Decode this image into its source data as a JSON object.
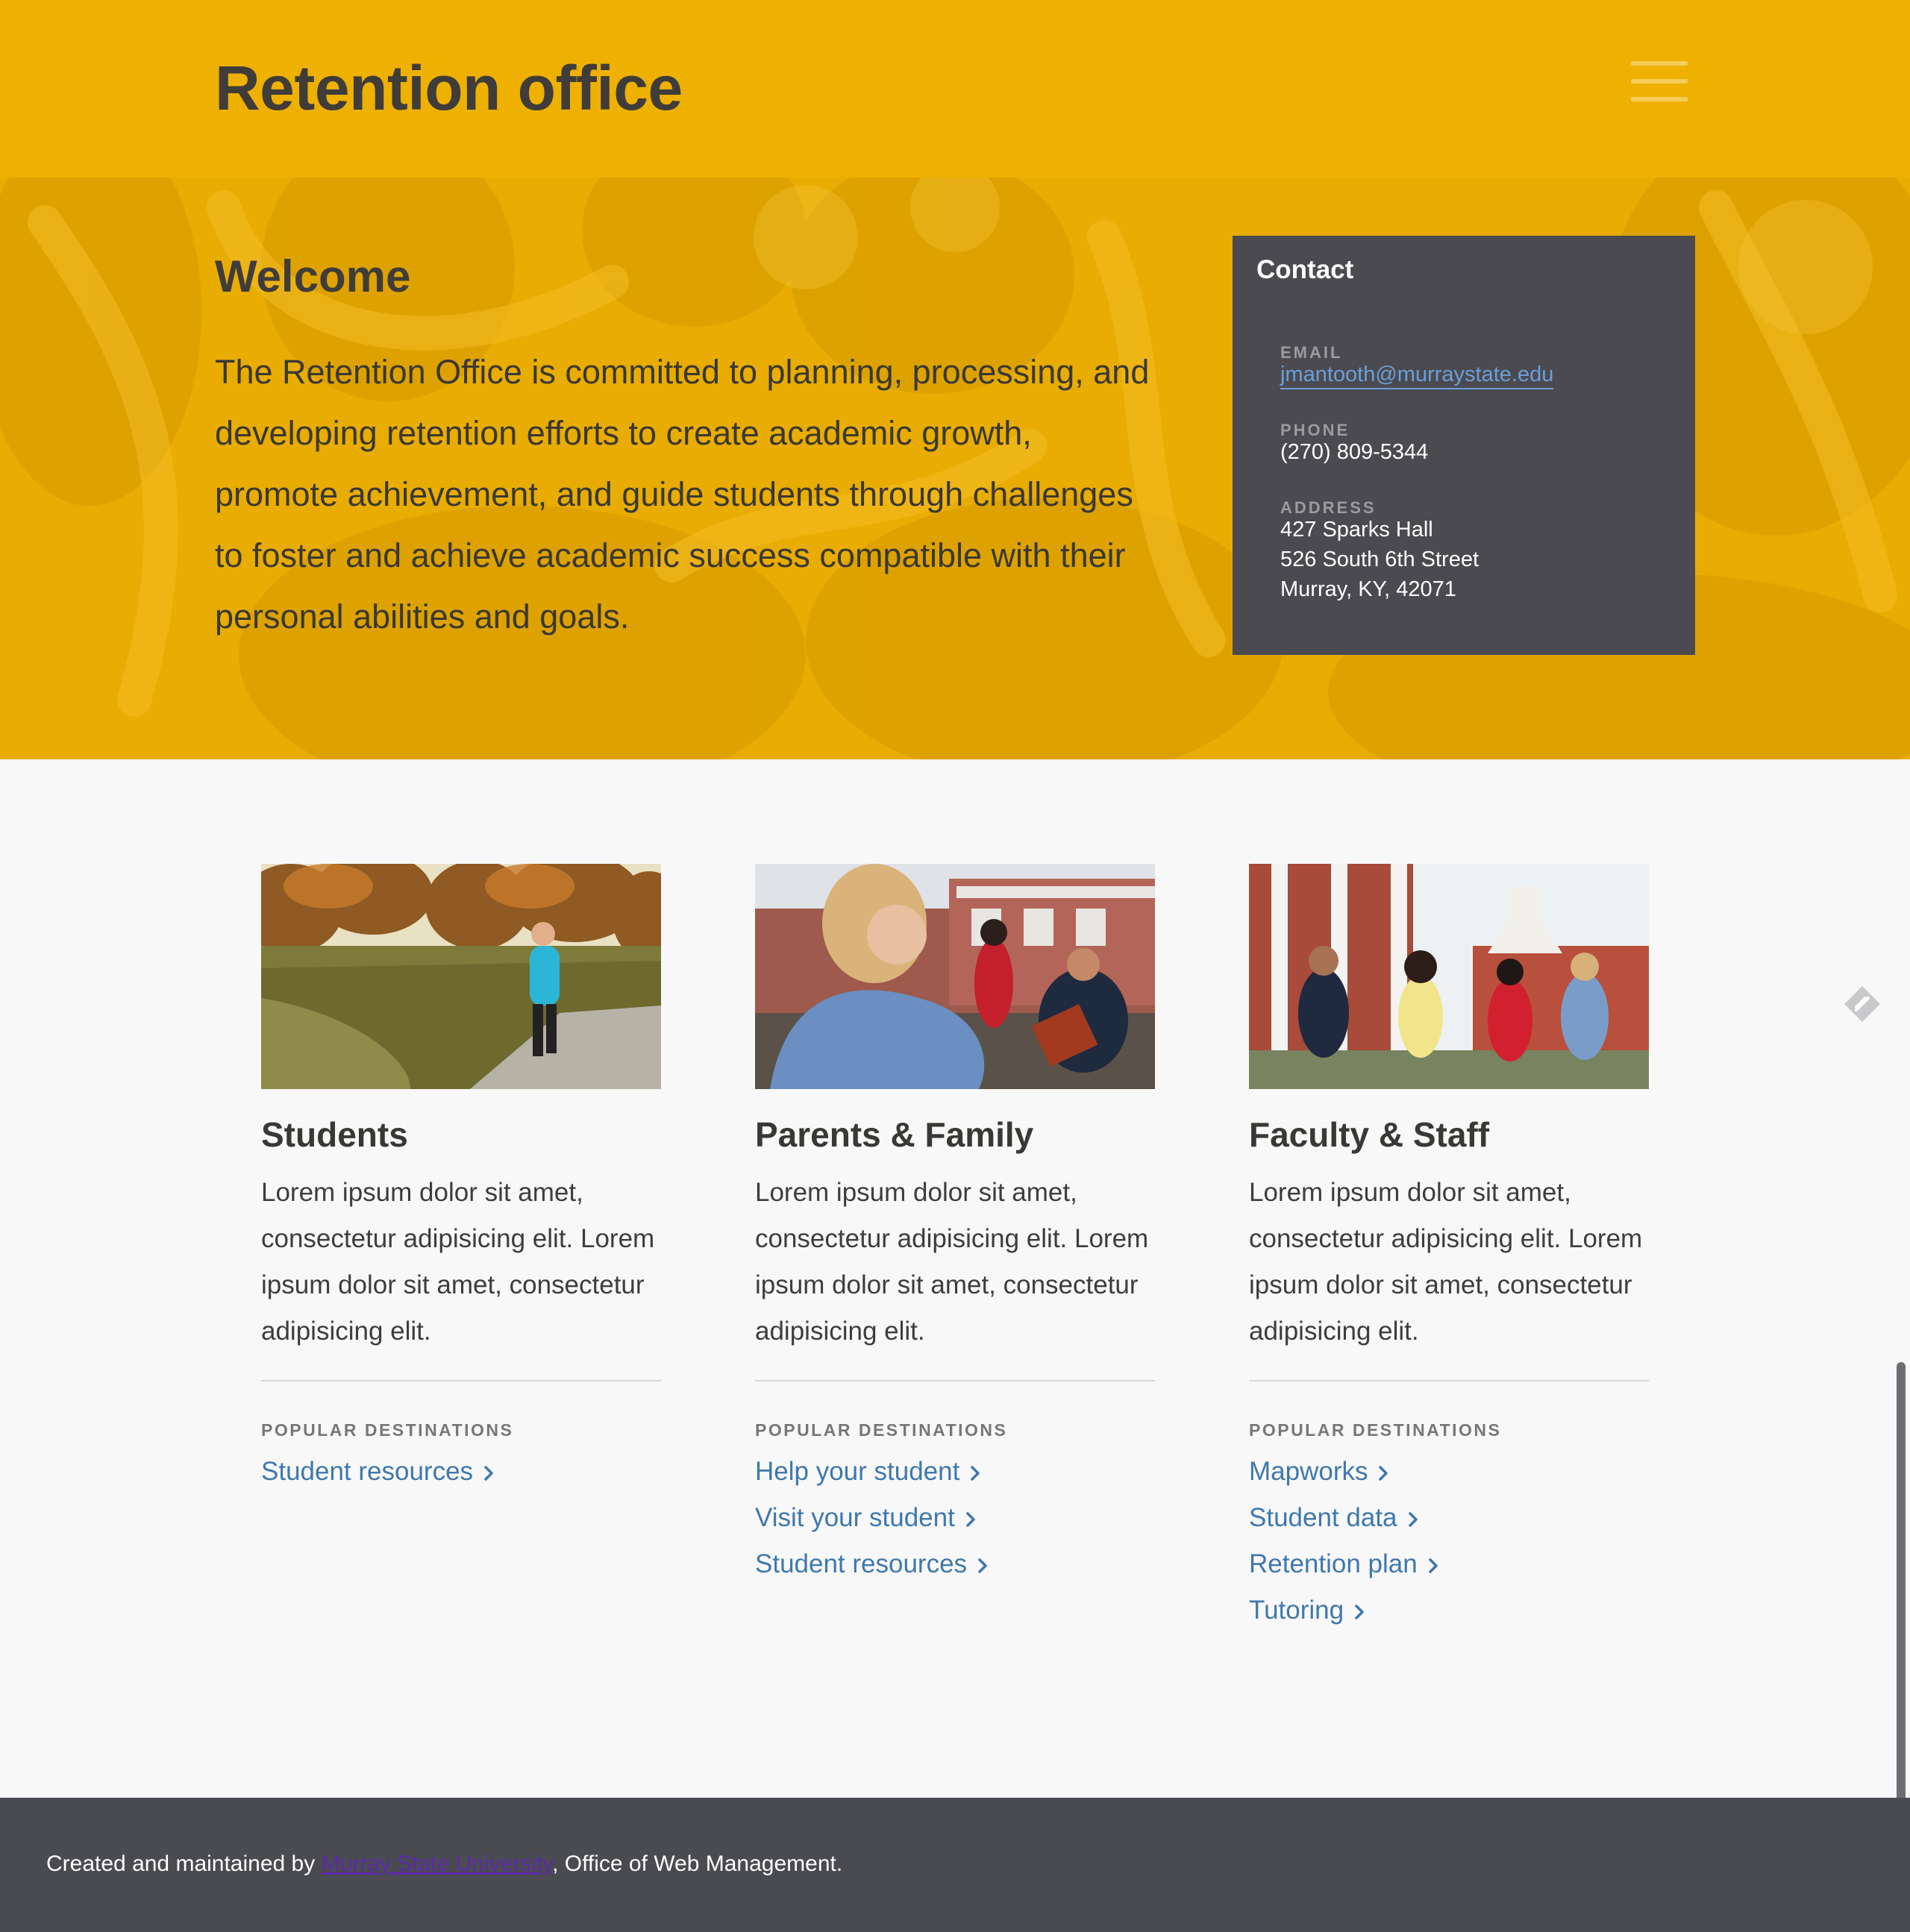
{
  "header": {
    "title": "Retention office",
    "menu_icon": "hamburger-menu-icon"
  },
  "hero": {
    "heading": "Welcome",
    "text": "The Retention Office is committed to planning, processing, and developing retention efforts to create academic growth, promote achievement, and guide students through challenges to foster and achieve academic success compatible with their personal abilities and goals."
  },
  "contact": {
    "title": "Contact",
    "email_label": "EMAIL",
    "email": "jmantooth@murraystate.edu",
    "phone_label": "PHONE",
    "phone": "(270) 809-5344",
    "address_label": "ADDRESS",
    "address_lines": [
      "427 Sparks Hall",
      "526 South 6th Street",
      "Murray, KY, 42071"
    ]
  },
  "cards": [
    {
      "title": "Students",
      "text": "Lorem ipsum dolor sit amet, consectetur adipisicing elit. Lorem ipsum dolor sit amet, consectetur adipisicing elit.",
      "dest_label": "POPULAR DESTINATIONS",
      "links": [
        "Student resources"
      ]
    },
    {
      "title": "Parents & Family",
      "text": "Lorem ipsum dolor sit amet, consectetur adipisicing elit. Lorem ipsum dolor sit amet, consectetur adipisicing elit.",
      "dest_label": "POPULAR DESTINATIONS",
      "links": [
        "Help your student",
        "Visit your student",
        "Student resources"
      ]
    },
    {
      "title": "Faculty & Staff",
      "text": "Lorem ipsum dolor sit amet, consectetur adipisicing elit. Lorem ipsum dolor sit amet, consectetur adipisicing elit.",
      "dest_label": "POPULAR DESTINATIONS",
      "links": [
        "Mapworks",
        "Student data",
        "Retention plan",
        "Tutoring"
      ]
    }
  ],
  "footer": {
    "prefix": "Created and maintained by ",
    "link": "Murray State University",
    "suffix": ", Office of Web Management."
  },
  "colors": {
    "brand_gold": "#eeb102",
    "dark_panel": "#4a4a50",
    "link_blue": "#3f78ad"
  }
}
